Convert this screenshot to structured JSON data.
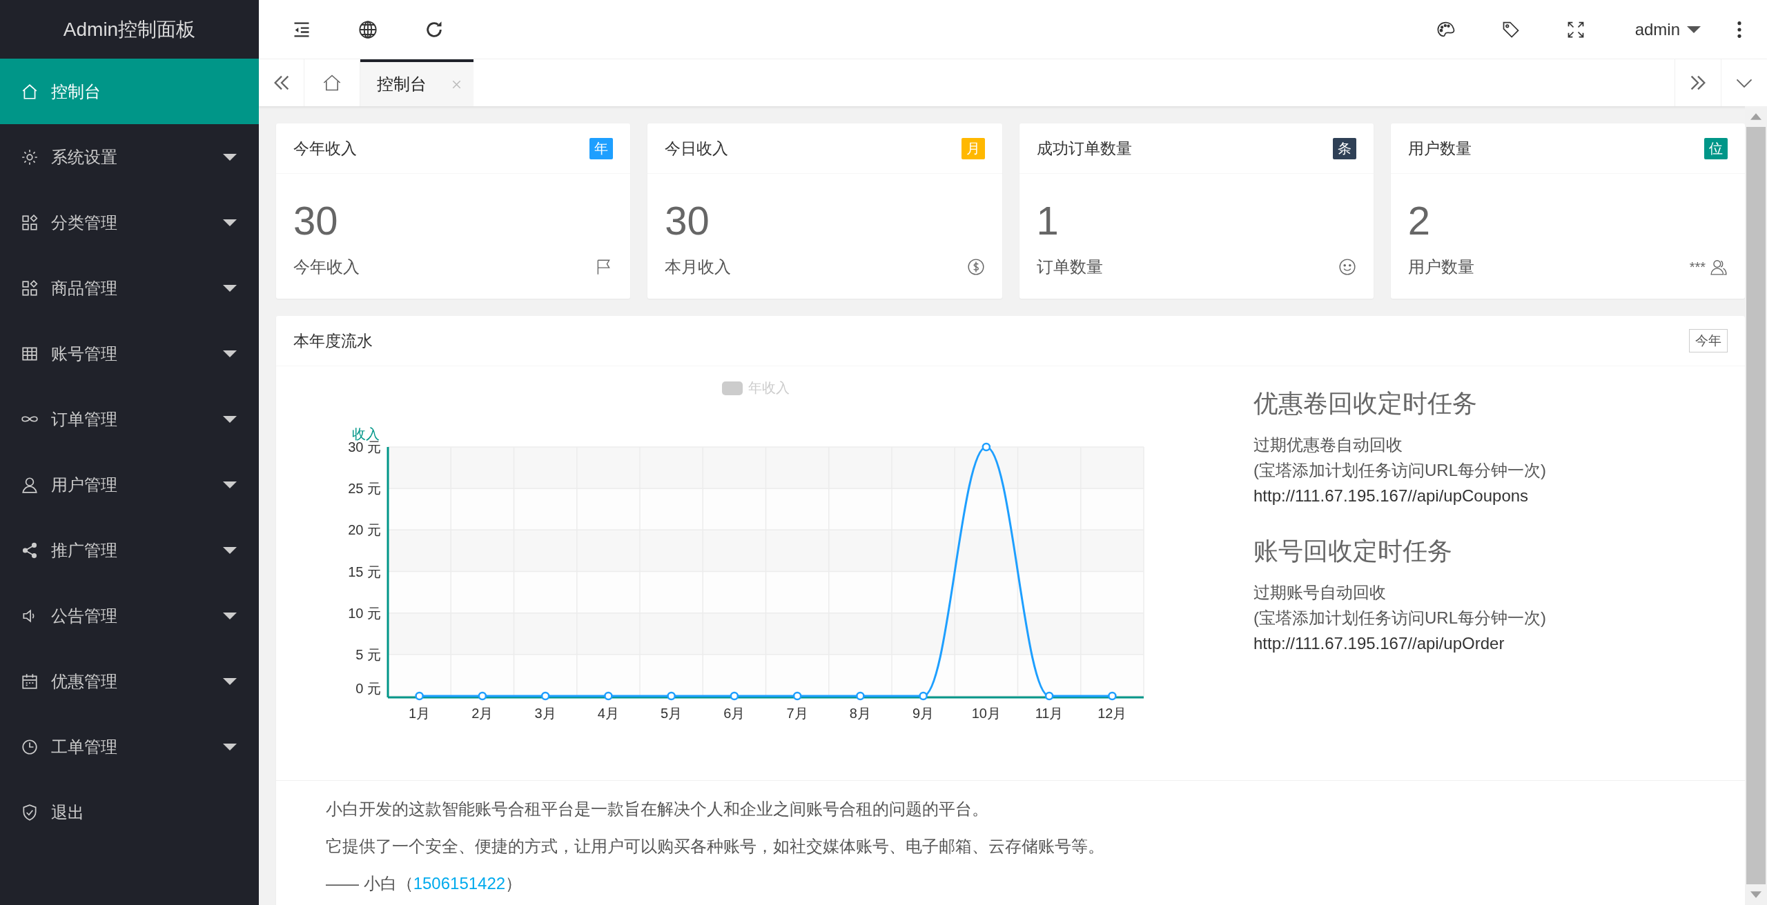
{
  "sidebar": {
    "title": "Admin控制面板",
    "items": [
      {
        "label": "控制台",
        "selected": true,
        "has_submenu": false
      },
      {
        "label": "系统设置",
        "selected": false,
        "has_submenu": true
      },
      {
        "label": "分类管理",
        "selected": false,
        "has_submenu": true
      },
      {
        "label": "商品管理",
        "selected": false,
        "has_submenu": true
      },
      {
        "label": "账号管理",
        "selected": false,
        "has_submenu": true
      },
      {
        "label": "订单管理",
        "selected": false,
        "has_submenu": true
      },
      {
        "label": "用户管理",
        "selected": false,
        "has_submenu": true
      },
      {
        "label": "推广管理",
        "selected": false,
        "has_submenu": true
      },
      {
        "label": "公告管理",
        "selected": false,
        "has_submenu": true
      },
      {
        "label": "优惠管理",
        "selected": false,
        "has_submenu": true
      },
      {
        "label": "工单管理",
        "selected": false,
        "has_submenu": true
      },
      {
        "label": "退出",
        "selected": false,
        "has_submenu": false
      }
    ]
  },
  "header": {
    "user": "admin"
  },
  "tabs": [
    {
      "label": "控制台",
      "selected": true
    }
  ],
  "stats": [
    {
      "title": "今年收入",
      "badge": "年",
      "color": "#1e9fff",
      "value": "30",
      "label": "今年收入"
    },
    {
      "title": "今日收入",
      "badge": "月",
      "color": "#ffb800",
      "value": "30",
      "label": "本月收入"
    },
    {
      "title": "成功订单数量",
      "badge": "条",
      "color": "#2f4056",
      "value": "1",
      "label": "订单数量"
    },
    {
      "title": "用户数量",
      "badge": "位",
      "color": "#009688",
      "value": "2",
      "label": "用户数量",
      "extra": "***"
    }
  ],
  "flow": {
    "title": "本年度流水",
    "badge": "今年",
    "chart_data": {
      "type": "line",
      "ylabel": "收入",
      "categories": [
        "1月",
        "2月",
        "3月",
        "4月",
        "5月",
        "6月",
        "7月",
        "8月",
        "9月",
        "10月",
        "11月",
        "12月"
      ],
      "series": [
        {
          "name": "年收入",
          "color": "#1e9fff",
          "marker": "circle",
          "values": [
            0,
            0,
            0,
            0,
            0,
            0,
            0,
            0,
            0,
            30,
            0,
            0
          ]
        }
      ],
      "grid": true,
      "ylim": [
        0,
        30
      ],
      "yticks": [
        {
          "value": 0,
          "label": "0 元"
        },
        {
          "value": 5,
          "label": "5 元"
        },
        {
          "value": 10,
          "label": "10 元"
        },
        {
          "value": 15,
          "label": "15 元"
        },
        {
          "value": 20,
          "label": "20 元"
        },
        {
          "value": 25,
          "label": "25 元"
        },
        {
          "value": 30,
          "label": "30 元"
        }
      ]
    },
    "tasks": [
      {
        "title": "优惠卷回收定时任务",
        "lines": [
          "过期优惠卷自动回收",
          "(宝塔添加计划任务访问URL每分钟一次)",
          "http://111.67.195.167//api/upCoupons"
        ]
      },
      {
        "title": "账号回收定时任务",
        "lines": [
          "过期账号自动回收",
          "(宝塔添加计划任务访问URL每分钟一次)",
          "http://111.67.195.167//api/upOrder"
        ]
      }
    ],
    "paragraphs": [
      "小白开发的这款智能账号合租平台是一款旨在解决个人和企业之间账号合租的问题的平台。",
      "它提供了一个安全、便捷的方式，让用户可以购买各种账号，如社交媒体账号、电子邮箱、云存储账号等。"
    ],
    "signature": {
      "prefix": "—— 小白（",
      "link": "1506151422",
      "suffix": "）"
    }
  }
}
